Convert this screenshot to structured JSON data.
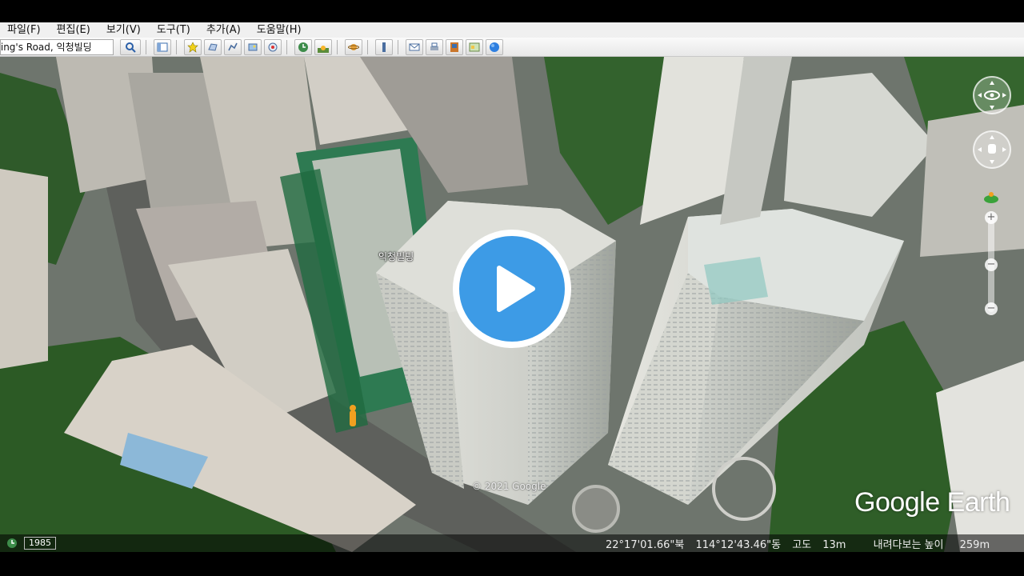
{
  "menubar": {
    "items": [
      "파일(F)",
      "편집(E)",
      "보기(V)",
      "도구(T)",
      "추가(A)",
      "도움말(H)"
    ]
  },
  "toolbar": {
    "search_value": "King's Road, 익청빌딩",
    "buttons": [
      "search-icon",
      "sidebar-icon",
      "placemark-icon",
      "polygon-icon",
      "path-icon",
      "overlay-icon",
      "tour-icon",
      "history-icon",
      "sun-icon",
      "planets-icon",
      "ruler-icon",
      "email-icon",
      "print-icon",
      "save-image-icon",
      "maps-icon",
      "earth-icon"
    ]
  },
  "map": {
    "place_label": "익청빌딩",
    "copyright": "© 2021 Google",
    "brand": "Google Earth"
  },
  "status": {
    "imagery_year": "1985",
    "latitude": "22°17'01.66\"북",
    "longitude": "114°12'43.46\"동",
    "elevation_label": "고도",
    "elevation": "13m",
    "eye_alt_label": "내려다보는 높이",
    "eye_alt": "259m"
  },
  "colors": {
    "play_blue": "#3d9be6",
    "status_bg": "#000000"
  }
}
